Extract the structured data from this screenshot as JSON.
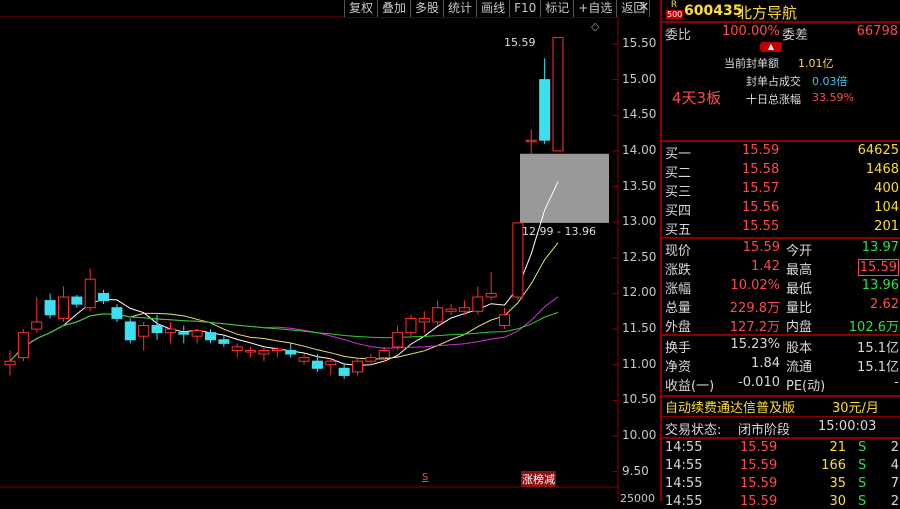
{
  "toolbar": {
    "buttons": [
      "复权",
      "叠加",
      "多股",
      "统计",
      "画线",
      "F10",
      "标记",
      "+自选",
      "返回"
    ],
    "close": "✕"
  },
  "chart": {
    "price_axis": [
      "15.50",
      "15.00",
      "14.50",
      "14.00",
      "13.50",
      "13.00",
      "12.50",
      "12.00",
      "11.50",
      "11.00",
      "10.50",
      "10.00",
      "9.50"
    ],
    "high_label": "15.59",
    "range_label": "12.99 - 13.96",
    "bottom_markers": {
      "s_marker": "S",
      "list_marker": "涨榜减"
    },
    "bottom_axis_partial": "25000",
    "colors": {
      "up": "#ff3030",
      "down": "#3ee0f0",
      "ma5": "#ffffff",
      "ma10": "#e8e070",
      "ma20": "#d030e0",
      "ma60": "#30d030"
    }
  },
  "chart_data": {
    "type": "candlestick",
    "ylim": [
      9.5,
      15.59
    ],
    "candles": [
      {
        "o": 11.0,
        "h": 11.2,
        "l": 10.85,
        "c": 11.05,
        "dir": "up"
      },
      {
        "o": 11.1,
        "h": 11.5,
        "l": 11.05,
        "c": 11.45,
        "dir": "up"
      },
      {
        "o": 11.5,
        "h": 11.95,
        "l": 11.45,
        "c": 11.6,
        "dir": "up"
      },
      {
        "o": 11.9,
        "h": 12.0,
        "l": 11.65,
        "c": 11.7,
        "dir": "down"
      },
      {
        "o": 11.65,
        "h": 12.1,
        "l": 11.6,
        "c": 11.95,
        "dir": "up"
      },
      {
        "o": 11.95,
        "h": 11.98,
        "l": 11.8,
        "c": 11.85,
        "dir": "down"
      },
      {
        "o": 11.8,
        "h": 12.35,
        "l": 11.75,
        "c": 12.2,
        "dir": "up"
      },
      {
        "o": 12.0,
        "h": 12.05,
        "l": 11.85,
        "c": 11.9,
        "dir": "down"
      },
      {
        "o": 11.8,
        "h": 11.85,
        "l": 11.6,
        "c": 11.65,
        "dir": "down"
      },
      {
        "o": 11.6,
        "h": 11.65,
        "l": 11.3,
        "c": 11.35,
        "dir": "down"
      },
      {
        "o": 11.4,
        "h": 11.6,
        "l": 11.2,
        "c": 11.55,
        "dir": "up"
      },
      {
        "o": 11.55,
        "h": 11.7,
        "l": 11.35,
        "c": 11.45,
        "dir": "down"
      },
      {
        "o": 11.45,
        "h": 11.6,
        "l": 11.3,
        "c": 11.5,
        "dir": "up"
      },
      {
        "o": 11.45,
        "h": 11.55,
        "l": 11.3,
        "c": 11.45,
        "dir": "down"
      },
      {
        "o": 11.4,
        "h": 11.5,
        "l": 11.3,
        "c": 11.48,
        "dir": "up"
      },
      {
        "o": 11.45,
        "h": 11.5,
        "l": 11.3,
        "c": 11.35,
        "dir": "down"
      },
      {
        "o": 11.35,
        "h": 11.4,
        "l": 11.25,
        "c": 11.3,
        "dir": "down"
      },
      {
        "o": 11.25,
        "h": 11.3,
        "l": 11.1,
        "c": 11.2,
        "dir": "up"
      },
      {
        "o": 11.2,
        "h": 11.25,
        "l": 11.1,
        "c": 11.2,
        "dir": "up"
      },
      {
        "o": 11.15,
        "h": 11.25,
        "l": 11.05,
        "c": 11.2,
        "dir": "up"
      },
      {
        "o": 11.2,
        "h": 11.25,
        "l": 11.1,
        "c": 11.22,
        "dir": "up"
      },
      {
        "o": 11.2,
        "h": 11.3,
        "l": 11.1,
        "c": 11.15,
        "dir": "down"
      },
      {
        "o": 11.1,
        "h": 11.15,
        "l": 11.0,
        "c": 11.05,
        "dir": "up"
      },
      {
        "o": 11.05,
        "h": 11.15,
        "l": 10.9,
        "c": 10.95,
        "dir": "down"
      },
      {
        "o": 11.0,
        "h": 11.1,
        "l": 10.85,
        "c": 11.05,
        "dir": "up"
      },
      {
        "o": 10.95,
        "h": 11.0,
        "l": 10.8,
        "c": 10.85,
        "dir": "down"
      },
      {
        "o": 10.9,
        "h": 11.1,
        "l": 10.85,
        "c": 11.05,
        "dir": "up"
      },
      {
        "o": 11.05,
        "h": 11.15,
        "l": 11.0,
        "c": 11.1,
        "dir": "up"
      },
      {
        "o": 11.1,
        "h": 11.25,
        "l": 11.05,
        "c": 11.2,
        "dir": "up"
      },
      {
        "o": 11.25,
        "h": 11.55,
        "l": 11.2,
        "c": 11.45,
        "dir": "up"
      },
      {
        "o": 11.45,
        "h": 11.7,
        "l": 11.4,
        "c": 11.65,
        "dir": "up"
      },
      {
        "o": 11.65,
        "h": 11.75,
        "l": 11.45,
        "c": 11.6,
        "dir": "up"
      },
      {
        "o": 11.6,
        "h": 11.9,
        "l": 11.55,
        "c": 11.8,
        "dir": "up"
      },
      {
        "o": 11.75,
        "h": 11.85,
        "l": 11.7,
        "c": 11.78,
        "dir": "up"
      },
      {
        "o": 11.8,
        "h": 11.9,
        "l": 11.7,
        "c": 11.75,
        "dir": "up"
      },
      {
        "o": 11.75,
        "h": 12.1,
        "l": 11.7,
        "c": 11.95,
        "dir": "up"
      },
      {
        "o": 11.95,
        "h": 12.3,
        "l": 11.9,
        "c": 12.0,
        "dir": "up"
      },
      {
        "o": 11.55,
        "h": 11.8,
        "l": 11.5,
        "c": 11.7,
        "dir": "up"
      },
      {
        "o": 11.95,
        "h": 13.0,
        "l": 11.9,
        "c": 12.99,
        "dir": "up"
      },
      {
        "o": 14.15,
        "h": 14.3,
        "l": 13.96,
        "c": 14.15,
        "dir": "up"
      },
      {
        "o": 14.15,
        "h": 15.3,
        "l": 14.1,
        "c": 15.0,
        "dir": "down"
      },
      {
        "o": 15.59,
        "h": 15.59,
        "l": 14.0,
        "c": 14.0,
        "dir": "up"
      }
    ],
    "gap_zone": [
      12.99,
      13.96
    ]
  },
  "panel": {
    "header": {
      "badge_r": "R",
      "badge_num": "500",
      "code": "600435",
      "name": "北方导航"
    },
    "ratio": {
      "label1": "委比",
      "value1": "100.00%",
      "label2": "委差",
      "value2": "66798"
    },
    "seal": [
      {
        "label": "当前封单额",
        "value": "1.01亿"
      },
      {
        "label": "封单占成交",
        "value": "0.03倍"
      },
      {
        "label": "十日总涨幅",
        "value": "33.59%"
      }
    ],
    "board_text": "4天3板",
    "bids": [
      {
        "label": "买一",
        "price": "15.59",
        "vol": "64625"
      },
      {
        "label": "买二",
        "price": "15.58",
        "vol": "1468"
      },
      {
        "label": "买三",
        "price": "15.57",
        "vol": "400"
      },
      {
        "label": "买四",
        "price": "15.56",
        "vol": "104"
      },
      {
        "label": "买五",
        "price": "15.55",
        "vol": "201"
      }
    ],
    "stats": [
      {
        "l1": "现价",
        "v1": "15.59",
        "l2": "今开",
        "v2": "13.97"
      },
      {
        "l1": "涨跌",
        "v1": "1.42",
        "l2": "最高",
        "v2": "15.59"
      },
      {
        "l1": "涨幅",
        "v1": "10.02%",
        "l2": "最低",
        "v2": "13.96"
      },
      {
        "l1": "总量",
        "v1": "229.8万",
        "l2": "量比",
        "v2": "2.62"
      },
      {
        "l1": "外盘",
        "v1": "127.2万",
        "l2": "内盘",
        "v2": "102.6万"
      }
    ],
    "fund": [
      {
        "l1": "换手",
        "v1": "15.23%",
        "l2": "股本",
        "v2": "15.1亿"
      },
      {
        "l1": "净资",
        "v1": "1.84",
        "l2": "流通",
        "v2": "15.1亿"
      },
      {
        "l1": "收益(一)",
        "v1": "-0.010",
        "l2": "PE(动)",
        "v2": "-"
      }
    ],
    "ad": {
      "text": "自动续费通达信普及版",
      "price": "30元/月"
    },
    "status": {
      "label": "交易状态:",
      "value": "闭市阶段",
      "time": "15:00:03"
    },
    "ticks": [
      {
        "time": "14:55",
        "price": "15.59",
        "vol": "21",
        "side": "S",
        "n": "2"
      },
      {
        "time": "14:55",
        "price": "15.59",
        "vol": "166",
        "side": "S",
        "n": "4"
      },
      {
        "time": "14:55",
        "price": "15.59",
        "vol": "35",
        "side": "S",
        "n": "7"
      },
      {
        "time": "14:55",
        "price": "15.59",
        "vol": "30",
        "side": "S",
        "n": "2"
      }
    ]
  }
}
